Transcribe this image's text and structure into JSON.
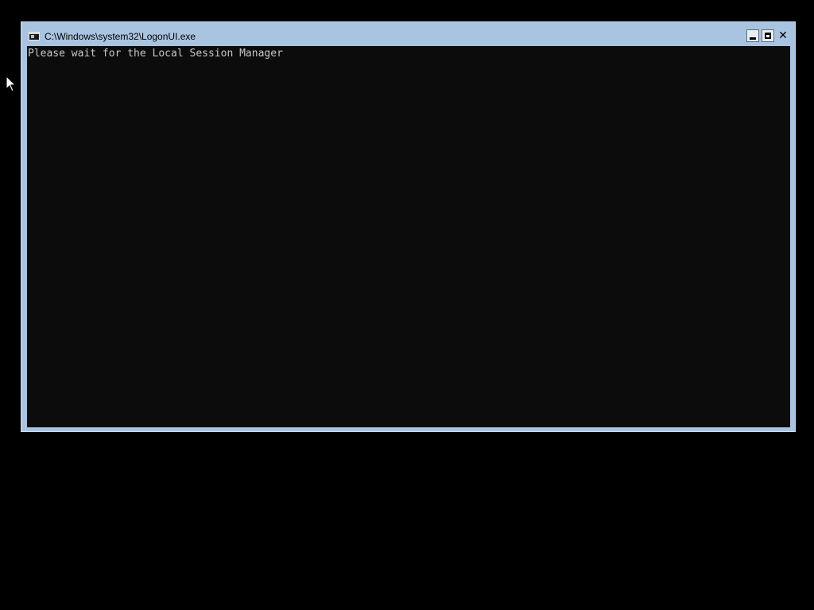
{
  "window": {
    "title": "C:\\Windows\\system32\\LogonUI.exe",
    "app_icon": "console-icon",
    "buttons": {
      "minimize": "minimize-icon",
      "maximize": "maximize-icon",
      "close": "✕"
    }
  },
  "console": {
    "lines": [
      "Please wait for the Local Session Manager"
    ]
  },
  "colors": {
    "desktop": "#000000",
    "window_frame": "#a9c4e0",
    "console_bg": "#0c0c0c",
    "console_text": "#c8c8c8"
  }
}
